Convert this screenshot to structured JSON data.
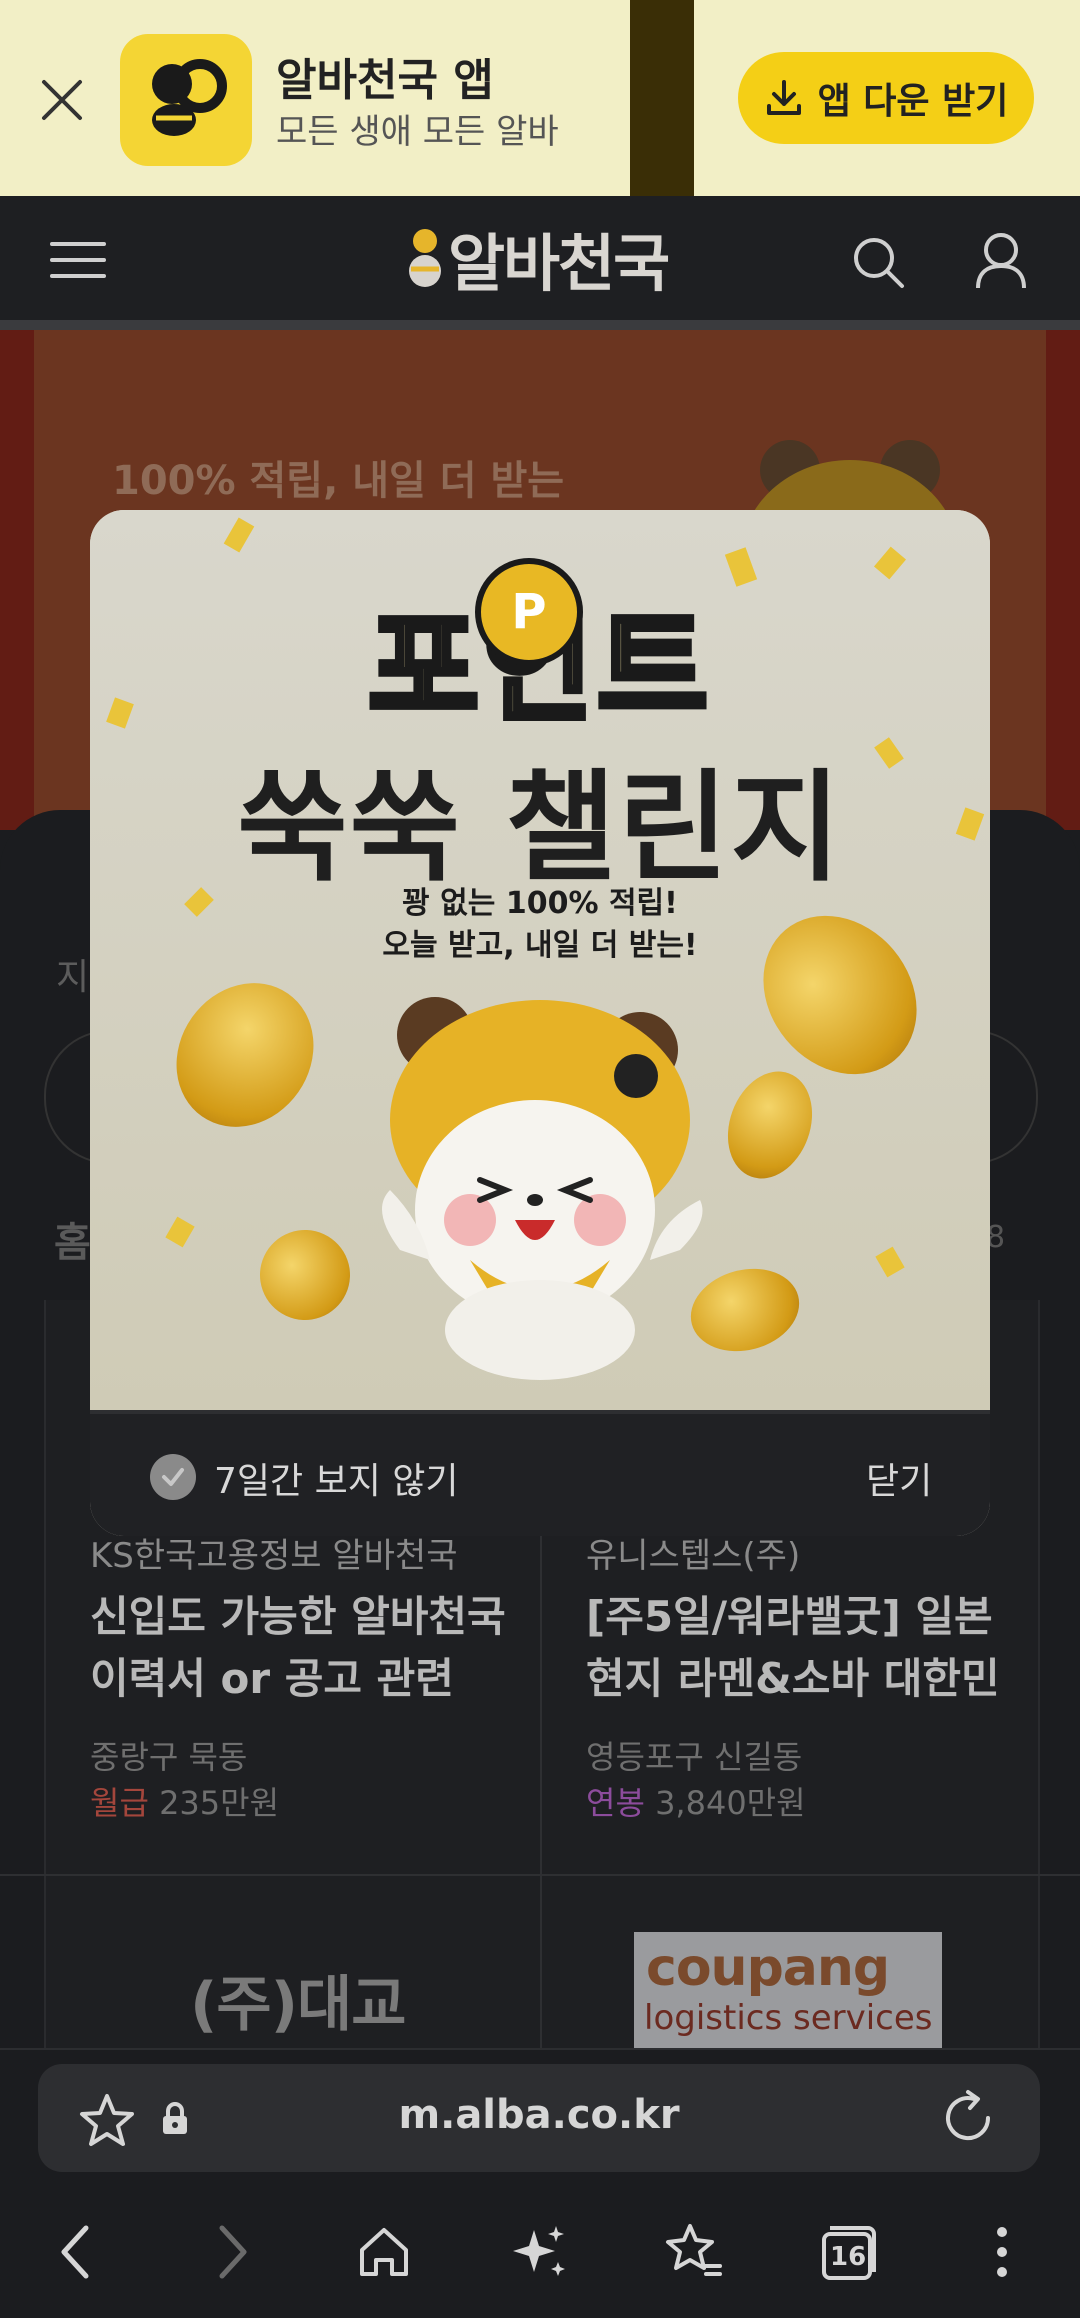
{
  "app_banner": {
    "title": "알바천국 앱",
    "subtitle": "모든 생애 모든 알바",
    "download_label": "앱 다운 받기"
  },
  "header": {
    "logo_text": "알바천국"
  },
  "hero": {
    "text": "100% 적립, 내일 더 받는"
  },
  "background": {
    "left_char": "지",
    "right_char": "!",
    "home_char": "홈",
    "count": "8"
  },
  "cards": [
    {
      "company": "KS한국고용정보 알바천국",
      "title": "신입도 가능한 알바천국 이력서 or 공고 관련",
      "location": "중랑구 묵동",
      "pay_type": "월급",
      "pay": "235만원"
    },
    {
      "company": "유니스텝스(주)",
      "title": "[주5일/워라밸굿] 일본현지 라멘&소바 대한민",
      "location": "영등포구 신길동",
      "pay_type": "연봉",
      "pay": "3,840만원"
    }
  ],
  "logos": {
    "daekyo": "(주)대교",
    "coupang_word": "coupang",
    "coupang_sub": "logistics services"
  },
  "popup": {
    "title_line1": "포인트",
    "coin_letter": "P",
    "title_line2": "쑥쑥 챌린지",
    "desc_line1": "꽝 없는 100% 적립!",
    "desc_line2": "오늘 받고, 내일 더 받는!",
    "dont_show_label": "7일간 보지 않기",
    "close_label": "닫기"
  },
  "browser": {
    "url": "m.alba.co.kr",
    "tab_count": "16"
  },
  "colors": {
    "brand_yellow": "#f4cf16",
    "monthly_pay": "#a4463c",
    "annual_pay": "#8c4c9c"
  }
}
